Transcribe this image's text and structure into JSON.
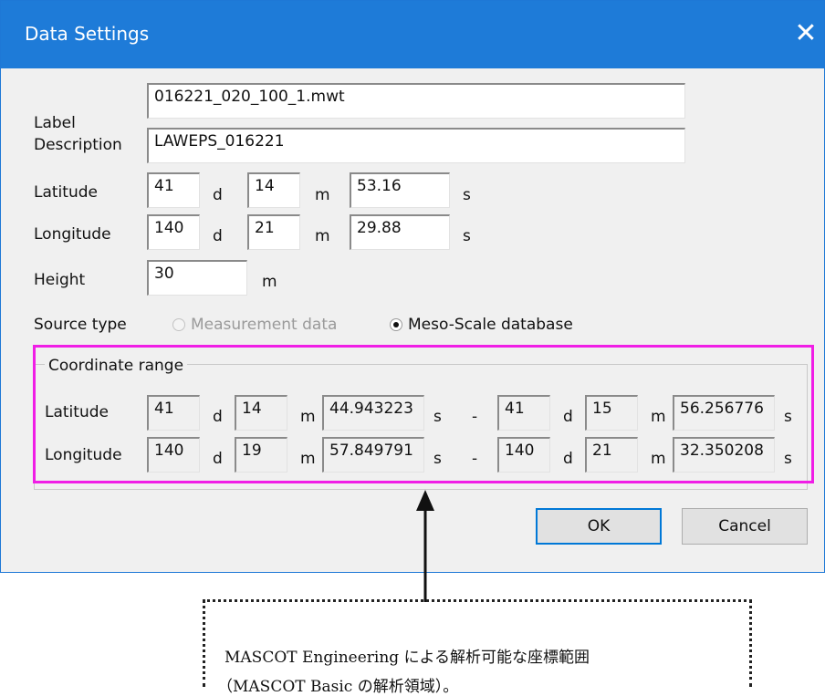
{
  "window": {
    "title": "Data Settings"
  },
  "form": {
    "label": {
      "label": "Label",
      "value": "016221_020_100_1.mwt"
    },
    "description": {
      "label": "Description",
      "value": "LAWEPS_016221"
    },
    "latitude": {
      "label": "Latitude",
      "deg": "41",
      "min": "14",
      "sec": "53.16"
    },
    "longitude": {
      "label": "Longitude",
      "deg": "140",
      "min": "21",
      "sec": "29.88"
    },
    "height": {
      "label": "Height",
      "value": "30",
      "unit": "m"
    },
    "units": {
      "d": "d",
      "m": "m",
      "s": "s"
    },
    "source_type": {
      "label": "Source type",
      "options": [
        {
          "label": "Measurement data",
          "selected": false,
          "enabled": false
        },
        {
          "label": "Meso-Scale database",
          "selected": true,
          "enabled": true
        }
      ]
    }
  },
  "coordinate_range": {
    "title": "Coordinate range",
    "separator": "-",
    "latitude": {
      "label": "Latitude",
      "from": {
        "deg": "41",
        "min": "14",
        "sec": "44.943223"
      },
      "to": {
        "deg": "41",
        "min": "15",
        "sec": "56.256776"
      }
    },
    "longitude": {
      "label": "Longitude",
      "from": {
        "deg": "140",
        "min": "19",
        "sec": "57.849791"
      },
      "to": {
        "deg": "140",
        "min": "21",
        "sec": "32.350208"
      }
    }
  },
  "buttons": {
    "ok": "OK",
    "cancel": "Cancel"
  },
  "annotation": {
    "line1": "MASCOT Engineering による解析可能な座標範囲",
    "line2": "（MASCOT Basic の解析領域）。"
  },
  "colors": {
    "titlebar": "#1e7bd8",
    "highlight": "#f01ee6",
    "dialog_bg": "#f0f0f0"
  }
}
